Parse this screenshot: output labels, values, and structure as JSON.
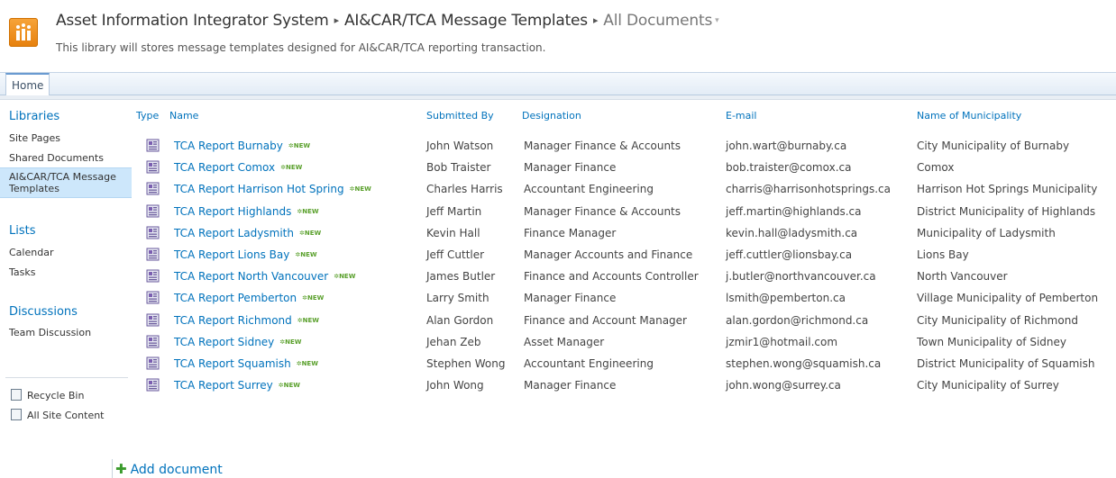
{
  "header": {
    "site_title": "Asset Information Integrator System",
    "library_title": "AI&CAR/TCA Message Templates",
    "view_name": "All Documents",
    "view_dropdown": "▾",
    "separator": "▸",
    "description": "This library will stores message templates designed for AI&CAR/TCA reporting transaction."
  },
  "ribbon": {
    "home_tab": "Home"
  },
  "quick_launch": {
    "libraries_heading": "Libraries",
    "libraries": [
      "Site Pages",
      "Shared Documents"
    ],
    "selected_line1": "AI&CAR/TCA Message",
    "selected_line2": "Templates",
    "lists_heading": "Lists",
    "lists": [
      "Calendar",
      "Tasks"
    ],
    "discussions_heading": "Discussions",
    "discussions": [
      "Team Discussion"
    ],
    "recycle_bin": "Recycle Bin",
    "all_site_content": "All Site Content"
  },
  "table": {
    "headers": {
      "type": "Type",
      "name": "Name",
      "submitted_by": "Submitted By",
      "designation": "Designation",
      "email": "E-mail",
      "municipality": "Name of Municipality"
    },
    "new_label": "NEW",
    "rows": [
      {
        "name": "TCA Report Burnaby",
        "submitted_by": "John Watson",
        "designation": "Manager Finance & Accounts",
        "email": "john.wart@burnaby.ca",
        "municipality": "City Municipality of Burnaby"
      },
      {
        "name": "TCA Report Comox",
        "submitted_by": "Bob Traister",
        "designation": "Manager Finance",
        "email": "bob.traister@comox.ca",
        "municipality": "Comox"
      },
      {
        "name": "TCA Report Harrison Hot Spring",
        "submitted_by": "Charles Harris",
        "designation": "Accountant Engineering",
        "email": "charris@harrisonhotsprings.ca",
        "municipality": "Harrison Hot Springs Municipality"
      },
      {
        "name": "TCA Report Highlands",
        "submitted_by": "Jeff Martin",
        "designation": "Manager Finance & Accounts",
        "email": "jeff.martin@highlands.ca",
        "municipality": "District Municipality of Highlands"
      },
      {
        "name": "TCA Report Ladysmith",
        "submitted_by": "Kevin Hall",
        "designation": "Finance Manager",
        "email": "kevin.hall@ladysmith.ca",
        "municipality": "Municipality of Ladysmith"
      },
      {
        "name": "TCA Report Lions Bay",
        "submitted_by": "Jeff Cuttler",
        "designation": "Manager Accounts and Finance",
        "email": "jeff.cuttler@lionsbay.ca",
        "municipality": "Lions Bay"
      },
      {
        "name": "TCA Report North Vancouver",
        "submitted_by": "James Butler",
        "designation": "Finance and Accounts Controller",
        "email": "j.butler@northvancouver.ca",
        "municipality": "North Vancouver"
      },
      {
        "name": "TCA Report Pemberton",
        "submitted_by": "Larry Smith",
        "designation": "Manager Finance",
        "email": "lsmith@pemberton.ca",
        "municipality": "Village Municipality of Pemberton"
      },
      {
        "name": "TCA Report Richmond",
        "submitted_by": "Alan Gordon",
        "designation": "Finance and Account Manager",
        "email": "alan.gordon@richmond.ca",
        "municipality": "City Municipality of Richmond"
      },
      {
        "name": "TCA Report Sidney",
        "submitted_by": "Jehan Zeb",
        "designation": "Asset Manager",
        "email": "jzmir1@hotmail.com",
        "municipality": "Town Municipality of Sidney"
      },
      {
        "name": "TCA Report Squamish",
        "submitted_by": "Stephen Wong",
        "designation": "Accountant Engineering",
        "email": "stephen.wong@squamish.ca",
        "municipality": "District Municipality of Squamish"
      },
      {
        "name": "TCA Report Surrey",
        "submitted_by": "John Wong",
        "designation": "Manager Finance",
        "email": "john.wong@surrey.ca",
        "municipality": "City Municipality of Surrey"
      }
    ]
  },
  "add_document": "Add document",
  "colors": {
    "link": "#0072bc",
    "selected_nav": "#cde7fb",
    "new_badge": "#5aa02c"
  }
}
